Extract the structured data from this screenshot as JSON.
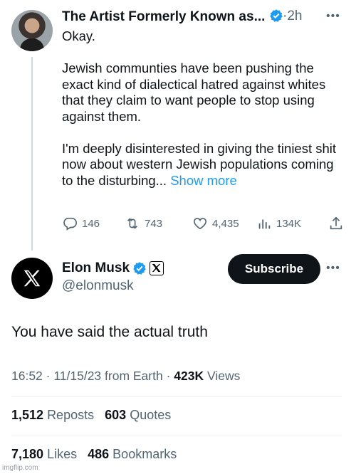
{
  "tweet1": {
    "author": "The Artist Formerly Known as...",
    "time": "2h",
    "text": "Okay.\n\nJewish communties have been pushing the exact kind of dialectical hatred against whites that they claim to want people to stop using against them.\n\nI'm deeply disinterested in giving the tiniest shit now about western Jewish populations coming to the disturbing...",
    "show_more": "Show more",
    "replies": "146",
    "reposts": "743",
    "likes": "4,435",
    "views": "134K"
  },
  "tweet2": {
    "author": "Elon Musk",
    "handle": "@elonmusk",
    "subscribe_label": "Subscribe",
    "text": "You have said the actual truth",
    "timestamp": "16:52 · 11/15/23 from Earth ·",
    "views_count": "423K",
    "views_label": "Views",
    "reposts_count": "1,512",
    "reposts_label": "Reposts",
    "quotes_count": "603",
    "quotes_label": "Quotes",
    "likes_count": "7,180",
    "likes_label": "Likes",
    "bookmarks_count": "486",
    "bookmarks_label": "Bookmarks"
  },
  "watermark": "imgflip.com",
  "colors": {
    "accent": "#1d9bf0",
    "text": "#0f1419",
    "muted": "#536471",
    "button": "#0f1419"
  }
}
